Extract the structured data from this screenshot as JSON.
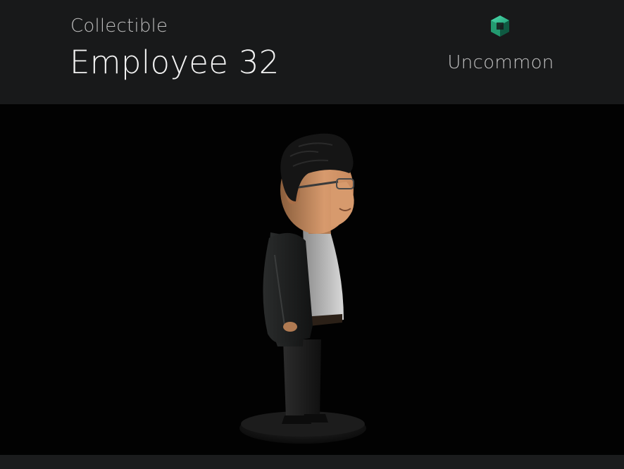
{
  "header": {
    "category": "Collectible",
    "title": "Employee 32",
    "rarity": {
      "label": "Uncommon",
      "icon": "rarity-cube-icon",
      "color": "#2fb58a"
    }
  },
  "viewer": {
    "subject": "figurine"
  }
}
